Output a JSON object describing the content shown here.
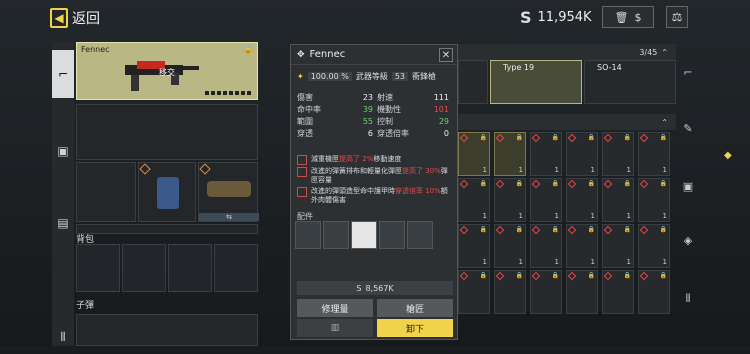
{
  "header": {
    "back_label": "返回",
    "currency_amount": "11,954K",
    "currency_icon": "S"
  },
  "selected_weapon": {
    "name": "Fennec",
    "tag": "移交"
  },
  "sections": {
    "backpack": "背包",
    "ammo": "子彈"
  },
  "popup": {
    "title": "Fennec",
    "durability": "100.00 %",
    "level_label": "武器等級",
    "level": "53",
    "mode": "衝鋒槍",
    "stats": [
      {
        "name": "傷害",
        "value": "23",
        "name2": "射速",
        "value2": "111",
        "hl2": false
      },
      {
        "name": "命中率",
        "value": "39",
        "name2": "機動性",
        "value2": "101",
        "hl2": true
      },
      {
        "name": "範圍",
        "value": "55",
        "name2": "控制",
        "value2": "29",
        "hl2": false
      },
      {
        "name": "穿透",
        "value": "6",
        "name2": "穿透倍率",
        "value2": "0",
        "hl2": false
      }
    ],
    "mods": [
      {
        "pre": "減重機匣",
        "hl": "提高了 2%",
        "post": "移動速度"
      },
      {
        "pre": "改進的彈簧排布和輕量化彈匣",
        "hl": "提高了 30%",
        "post": "彈匣容量"
      },
      {
        "pre": "改進的彈頭造型命中護甲時",
        "hl": "穿透倍率 10%",
        "post": "額外肉體傷害"
      }
    ],
    "attachments_label": "配件",
    "price": "8,567K",
    "btn_repair": "修理量",
    "btn_gunsmith": "槍匠",
    "btn_unequip": "卸下"
  },
  "stash": {
    "count": "3/45",
    "weapons": [
      {
        "name": "Type 19"
      },
      {
        "name": "SO-14"
      }
    ],
    "counts": [
      "1",
      "1",
      "1",
      "1",
      "1",
      "1",
      "1",
      "1",
      "1",
      "1",
      "1",
      "1",
      "1",
      "1",
      "1",
      "1",
      "1",
      "1"
    ]
  },
  "colors": {
    "accent": "#f0d34a",
    "alert": "#e64a4a"
  }
}
